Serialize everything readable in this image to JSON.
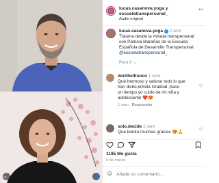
{
  "header": {
    "username_line1": "lucas.casanova.yoga y",
    "username_line2": "escuelatranspersonal_",
    "audio": "Audio original",
    "more": "..."
  },
  "caption": {
    "user": "lucas.casanova.yoga",
    "time": "2 sem",
    "lines": [
      "Trauma desde la mirada transpersonal",
      "con Patricia Marañas de la Escuela",
      "Española de Desarrollo Transpersonal",
      "@escuelatranspersonal_"
    ],
    "translate": "Para ti",
    "translate_arrow": "⌄"
  },
  "comments": [
    {
      "user": "dorithelfranco",
      "time": "1 sem",
      "lines": [
        "Qué hermoso y valioso todo lo que",
        "han dicho,infinita Gratitud ,hace",
        "un tiempo yo cuido de mi niña y",
        "adolescente ❤️😍"
      ],
      "meta_time": "1 sem",
      "reply": "Responder"
    },
    {
      "user": "solo.decide",
      "time": "1 sem",
      "lines": [
        "Que bonito muchas gracias 😍🙏"
      ]
    }
  ],
  "actions": {
    "like_icon": "heart-outline-icon",
    "comment_icon": "comment-icon",
    "share_icon": "paper-plane-icon",
    "save_icon": "bookmark-icon"
  },
  "stats": {
    "likes": "1185 Me gusta",
    "date": "6 de marzo"
  },
  "add_comment": {
    "placeholder": "Añade un comentario...",
    "emoji": "☺"
  },
  "colors": {
    "link": "#00376b",
    "muted": "#8e8e8e",
    "heart_red": "#ed4956"
  }
}
